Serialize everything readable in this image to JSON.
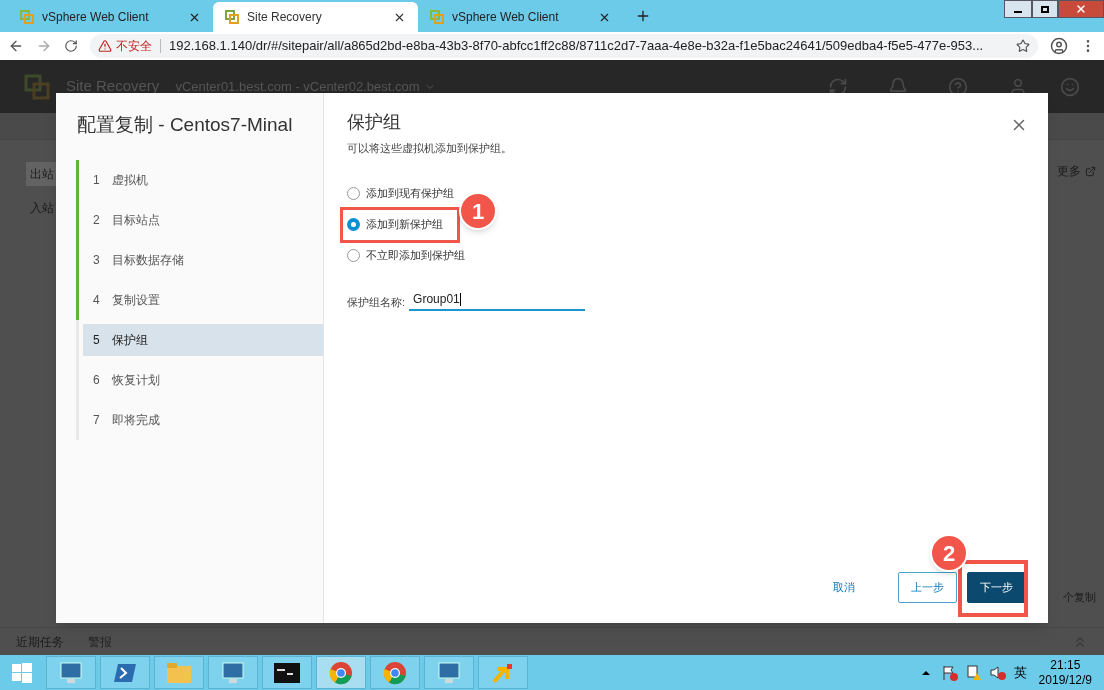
{
  "browser": {
    "tabs": [
      {
        "label": "vSphere Web Client",
        "selected": false
      },
      {
        "label": "Site Recovery",
        "selected": true
      },
      {
        "label": "vSphere Web Client",
        "selected": false
      }
    ],
    "security_label": "不安全",
    "url": "192.168.1.140/dr/#/sitepair/all/a865d2bd-e8ba-43b3-8f70-abfcc1ff2c88/8711c2d7-7aaa-4e8e-b32a-f1e5bac24641/509edba4-f5e5-477e-953..."
  },
  "app": {
    "title": "Site Recovery",
    "site_pair": "vCenter01.best.com - vCenter02.best.com",
    "side_items": [
      {
        "label": "出站",
        "selected": true
      },
      {
        "label": "入站",
        "selected": false
      }
    ],
    "more_link": "更多",
    "background_button": "个复制",
    "bottom_tabs": [
      "近期任务",
      "警报"
    ]
  },
  "dialog": {
    "title": "配置复制 - Centos7-Minal",
    "steps": [
      {
        "number": "1",
        "label": "虚拟机",
        "done": true,
        "selected": false
      },
      {
        "number": "2",
        "label": "目标站点",
        "done": true,
        "selected": false
      },
      {
        "number": "3",
        "label": "目标数据存储",
        "done": true,
        "selected": false
      },
      {
        "number": "4",
        "label": "复制设置",
        "done": true,
        "selected": false
      },
      {
        "number": "5",
        "label": "保护组",
        "done": false,
        "selected": true
      },
      {
        "number": "6",
        "label": "恢复计划",
        "done": false,
        "selected": false
      },
      {
        "number": "7",
        "label": "即将完成",
        "done": false,
        "selected": false
      }
    ],
    "page_title": "保护组",
    "description": "可以将这些虚拟机添加到保护组。",
    "options": [
      {
        "label": "添加到现有保护组",
        "selected": false
      },
      {
        "label": "添加到新保护组",
        "selected": true
      },
      {
        "label": "不立即添加到保护组",
        "selected": false
      }
    ],
    "name_label": "保护组名称:",
    "name_value": "Group01",
    "buttons": [
      {
        "label": "取消",
        "kind": "link"
      },
      {
        "label": "上一步",
        "kind": "outline"
      },
      {
        "label": "下一步",
        "kind": "primary"
      }
    ]
  },
  "annotations": [
    {
      "number": "1"
    },
    {
      "number": "2"
    }
  ],
  "taskbar": {
    "time": "21:15",
    "date": "2019/12/9",
    "ime": "英"
  }
}
